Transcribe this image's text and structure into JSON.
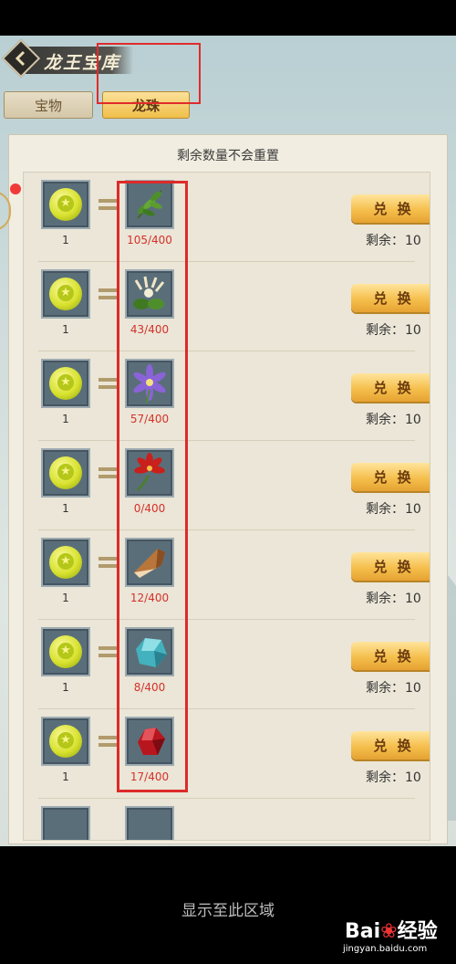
{
  "header": {
    "title": "龙王宝库"
  },
  "tabs": [
    {
      "label": "宝物",
      "active": false
    },
    {
      "label": "龙珠",
      "active": true
    }
  ],
  "panel": {
    "note": "剩余数量不会重置"
  },
  "rows": [
    {
      "coin_qty": "1",
      "item": "leaf-herb-icon",
      "progress": "105/400",
      "button": "兑 换",
      "remain_label": "剩余：",
      "remain_value": "10"
    },
    {
      "coin_qty": "1",
      "item": "honeysuckle-icon",
      "progress": "43/400",
      "button": "兑 换",
      "remain_label": "剩余：",
      "remain_value": "10"
    },
    {
      "coin_qty": "1",
      "item": "purple-flower-icon",
      "progress": "57/400",
      "button": "兑 换",
      "remain_label": "剩余：",
      "remain_value": "10"
    },
    {
      "coin_qty": "1",
      "item": "red-lotus-icon",
      "progress": "0/400",
      "button": "兑 换",
      "remain_label": "剩余：",
      "remain_value": "10"
    },
    {
      "coin_qty": "1",
      "item": "copper-ingot-icon",
      "progress": "12/400",
      "button": "兑 换",
      "remain_label": "剩余：",
      "remain_value": "10"
    },
    {
      "coin_qty": "1",
      "item": "jade-stone-icon",
      "progress": "8/400",
      "button": "兑 换",
      "remain_label": "剩余：",
      "remain_value": "10"
    },
    {
      "coin_qty": "1",
      "item": "red-crystal-icon",
      "progress": "17/400",
      "button": "兑 换",
      "remain_label": "剩余：",
      "remain_value": "10"
    }
  ],
  "footer": {
    "text": "显示至此区域"
  },
  "watermark": {
    "logo": "Bai du 经验",
    "url": "jingyan.baidu.com"
  },
  "colors": {
    "highlight": "#e02b2b",
    "gold_button": "#f5bf4d",
    "progress_text": "#d4312b"
  }
}
